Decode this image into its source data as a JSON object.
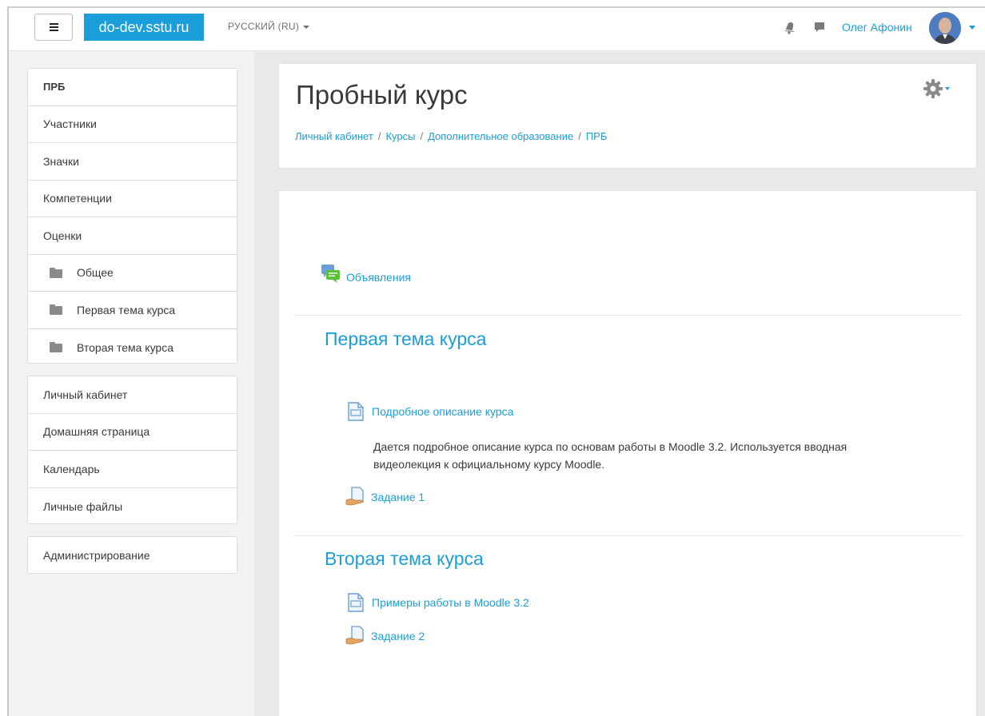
{
  "navbar": {
    "site_name": "do-dev.sstu.ru",
    "language": "РУССКИЙ (RU)",
    "user_name": "Олег Афонин",
    "icons": {
      "menu": "hamburger-icon",
      "notifications": "bell-icon",
      "messages": "chat-icon",
      "user_menu": "chevron-down-icon"
    }
  },
  "sidebar": {
    "course_block": [
      {
        "label": "ПРБ",
        "bold": true
      },
      {
        "label": "Участники"
      },
      {
        "label": "Значки"
      },
      {
        "label": "Компетенции"
      },
      {
        "label": "Оценки"
      },
      {
        "label": "Общее",
        "icon": "folder-icon"
      },
      {
        "label": "Первая тема курса",
        "icon": "folder-icon"
      },
      {
        "label": "Вторая тема курса",
        "icon": "folder-icon"
      }
    ],
    "site_block": [
      {
        "label": "Личный кабинет"
      },
      {
        "label": "Домашняя страница"
      },
      {
        "label": "Календарь"
      },
      {
        "label": "Личные файлы"
      }
    ],
    "admin_block": [
      {
        "label": "Администрирование"
      }
    ]
  },
  "header": {
    "title": "Пробный курс",
    "breadcrumb": [
      "Личный кабинет",
      "Курсы",
      "Дополнительное образование",
      "ПРБ"
    ],
    "breadcrumb_separator": "/"
  },
  "content": {
    "announcements": {
      "label": "Объявления",
      "icon": "forum-icon"
    },
    "sections": [
      {
        "title": "Первая тема курса",
        "activities": [
          {
            "label": "Подробное описание курса",
            "icon": "page-icon"
          },
          {
            "label": "Задание 1",
            "icon": "assignment-icon"
          }
        ],
        "summary": "Дается подробное описание курса по основам работы в Moodle 3.2. Используется вводная видеолекция к официальному курсу Moodle."
      },
      {
        "title": "Вторая тема курса",
        "activities": [
          {
            "label": "Примеры работы в Moodle 3.2",
            "icon": "page-icon"
          },
          {
            "label": "Задание 2",
            "icon": "assignment-icon"
          }
        ]
      }
    ]
  },
  "colors": {
    "brand": "#1b9ed9",
    "link": "#1b9ed9",
    "text": "#373a3c"
  }
}
